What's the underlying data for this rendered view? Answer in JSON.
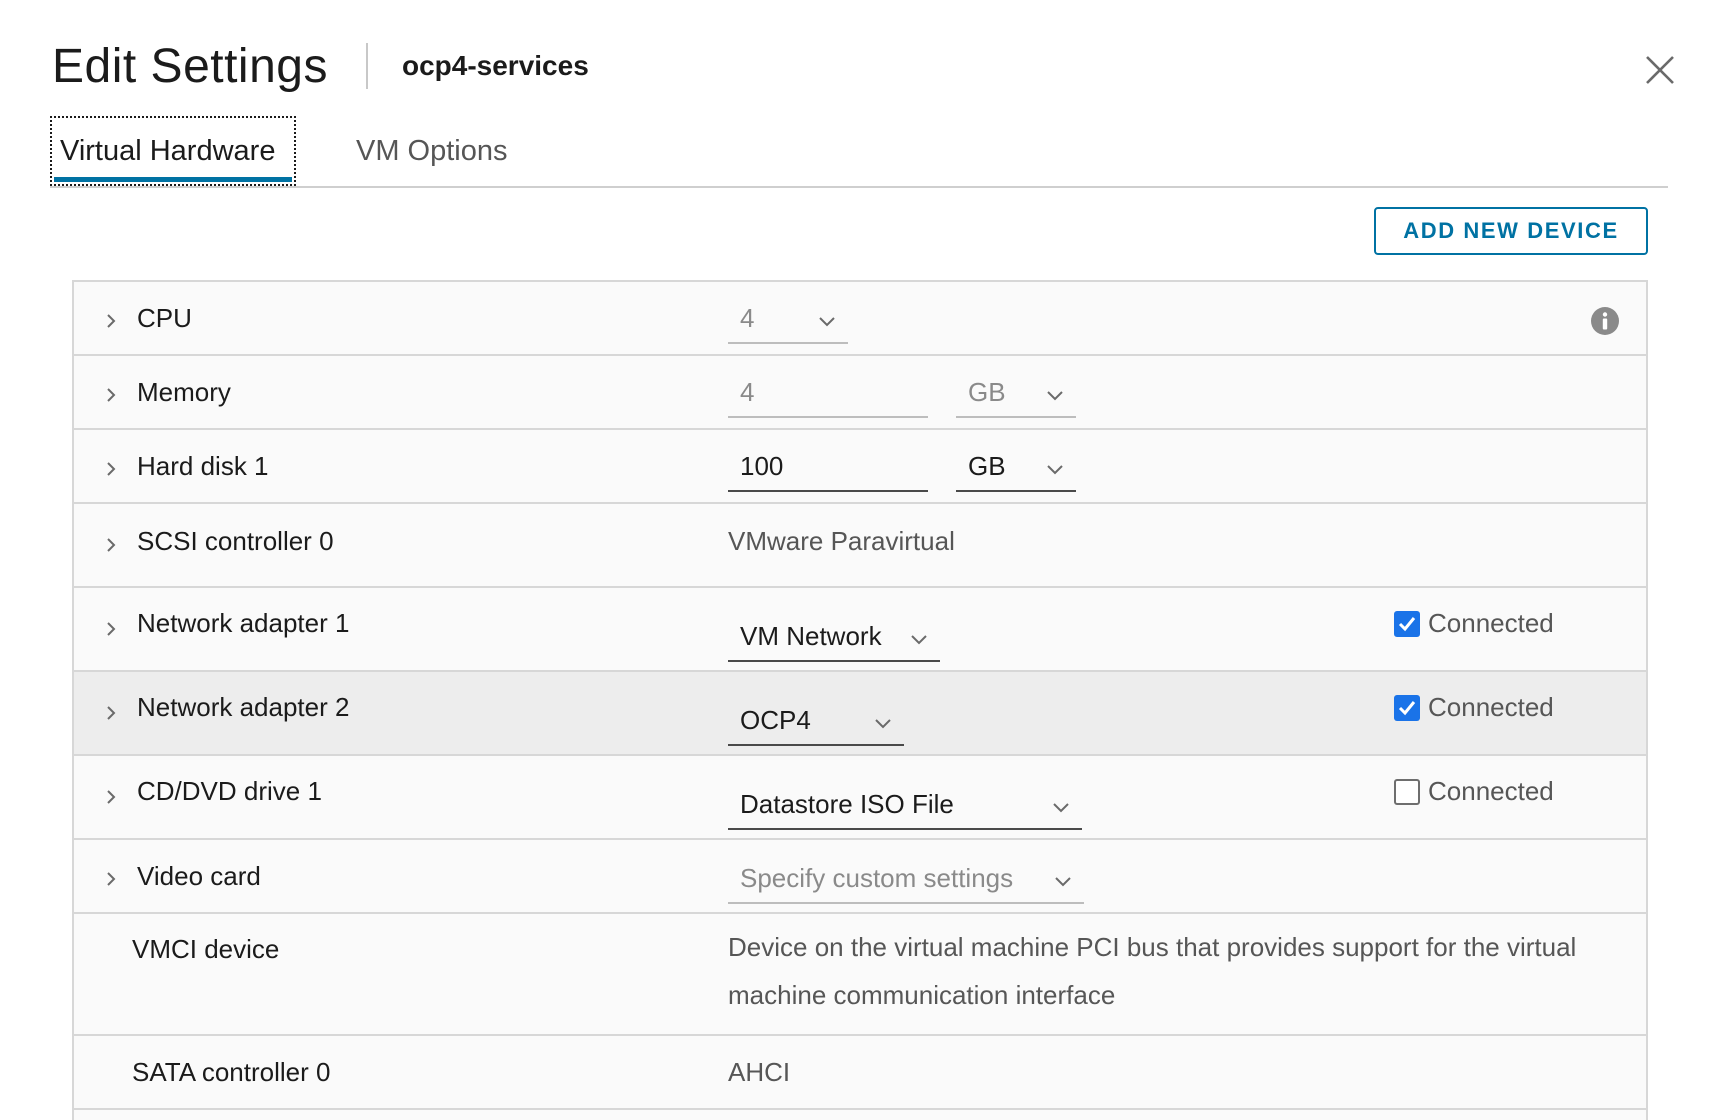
{
  "header": {
    "title": "Edit Settings",
    "vm_name": "ocp4-services"
  },
  "tabs": [
    {
      "label": "Virtual Hardware",
      "active": true
    },
    {
      "label": "VM Options",
      "active": false
    }
  ],
  "toolbar": {
    "add_device_label": "ADD NEW DEVICE"
  },
  "devices": [
    {
      "label": "CPU",
      "value": "4",
      "expandable": true,
      "disabled": true
    },
    {
      "label": "Memory",
      "value": "4",
      "unit": "GB",
      "expandable": true,
      "disabled": true
    },
    {
      "label": "Hard disk 1",
      "value": "100",
      "unit": "GB",
      "expandable": true,
      "disabled": false
    },
    {
      "label": "SCSI controller 0",
      "value": "VMware Paravirtual",
      "expandable": true
    },
    {
      "label": "Network adapter 1",
      "value": "VM Network",
      "connected": true,
      "connected_label": "Connected",
      "expandable": true
    },
    {
      "label": "Network adapter 2",
      "value": "OCP4",
      "connected": true,
      "connected_label": "Connected",
      "expandable": true,
      "highlighted": true
    },
    {
      "label": "CD/DVD drive 1",
      "value": "Datastore ISO File",
      "connected": false,
      "connected_label": "Connected",
      "expandable": true
    },
    {
      "label": "Video card",
      "value": "Specify custom settings",
      "expandable": true,
      "disabled": true
    },
    {
      "label": "VMCI device",
      "value": "Device on the virtual machine PCI bus that provides support for the virtual machine communication interface",
      "expandable": false
    },
    {
      "label": "SATA controller 0",
      "value": "AHCI",
      "expandable": false
    }
  ],
  "colors": {
    "accent": "#0072a3",
    "checkbox_checked": "#1a73e8",
    "row_highlight": "#ededed",
    "row_background": "#fafafa"
  },
  "icons": {
    "close": "close-icon",
    "expand": "chevron-right-icon",
    "dropdown": "chevron-down-icon",
    "info": "info-icon",
    "checkmark": "checkmark-icon"
  }
}
